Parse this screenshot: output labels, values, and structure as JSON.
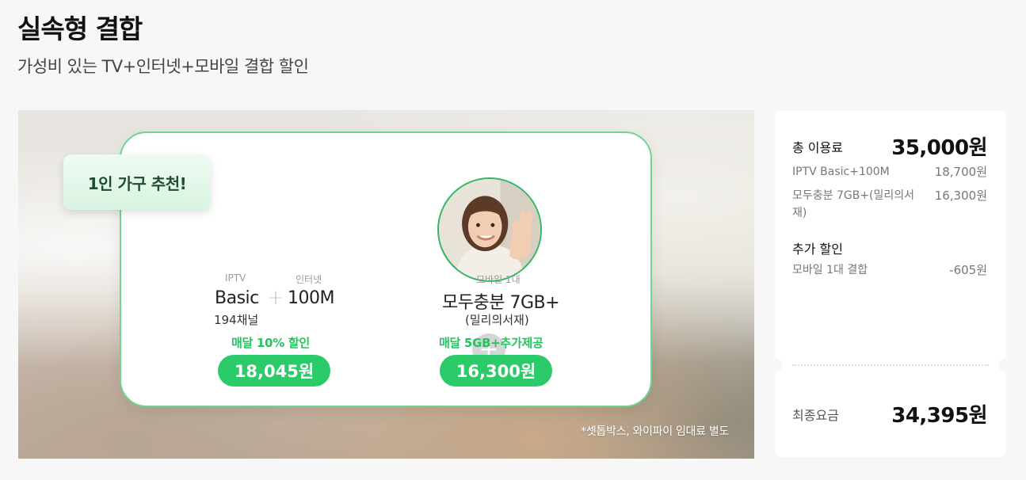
{
  "header": {
    "title": "실속형 결합",
    "subtitle": "가성비 있는 TV+인터넷+모바일 결합 할인"
  },
  "banner": {
    "badge": "1인 가구 추천!",
    "left_product": {
      "tv_small": "IPTV",
      "tv_name": "Basic",
      "tv_channels": "194채널",
      "plus": "+",
      "net_small": "인터넷",
      "net_name": "100M",
      "discount": "매달 10% 할인",
      "price": "18,045원"
    },
    "center_plus": "+",
    "right_product": {
      "small": "모바일 1대",
      "name": "모두충분 7GB+",
      "sub": "(밀리의서재)",
      "discount": "매달 5GB+추가제공",
      "price": "16,300원"
    },
    "note": "*셋톱박스, 와이파이 임대료 별도"
  },
  "summary": {
    "total_label": "총 이용료",
    "total_value": "35,000원",
    "items": [
      {
        "label": "IPTV Basic+100M",
        "value": "18,700원"
      },
      {
        "label": "모두충분 7GB+(밀리의서재)",
        "value": "16,300원"
      }
    ],
    "extra_title": "추가 할인",
    "extra_items": [
      {
        "label": "모바일 1대 결합",
        "value": "-605원"
      }
    ],
    "final_label": "최종요금",
    "final_value": "34,395원"
  },
  "colors": {
    "accent_green": "#2bcb6a",
    "discount_green": "#22c55e",
    "card_border": "#6fd591"
  }
}
